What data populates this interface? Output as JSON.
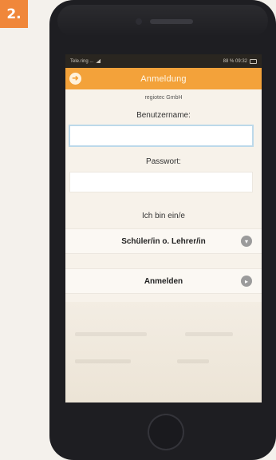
{
  "step_badge": "2.",
  "status_bar": {
    "left_text": "Tele.ring  ...",
    "right_text": "88 %   09:32"
  },
  "appbar": {
    "title": "Anmeldung",
    "back_icon": "arrow-left-circle-icon"
  },
  "form": {
    "company": "regiotec GmbH",
    "username_label": "Benutzername:",
    "username_value": "",
    "password_label": "Passwort:",
    "password_value": "",
    "role_label": "Ich bin ein/e",
    "role_value": "Schüler/in o. Lehrer/in",
    "role_icon": "chevron-down-circle-icon",
    "submit_label": "Anmelden",
    "submit_icon": "chevron-right-circle-icon"
  },
  "colors": {
    "accent": "#f3a23a",
    "badge": "#f0873a"
  }
}
